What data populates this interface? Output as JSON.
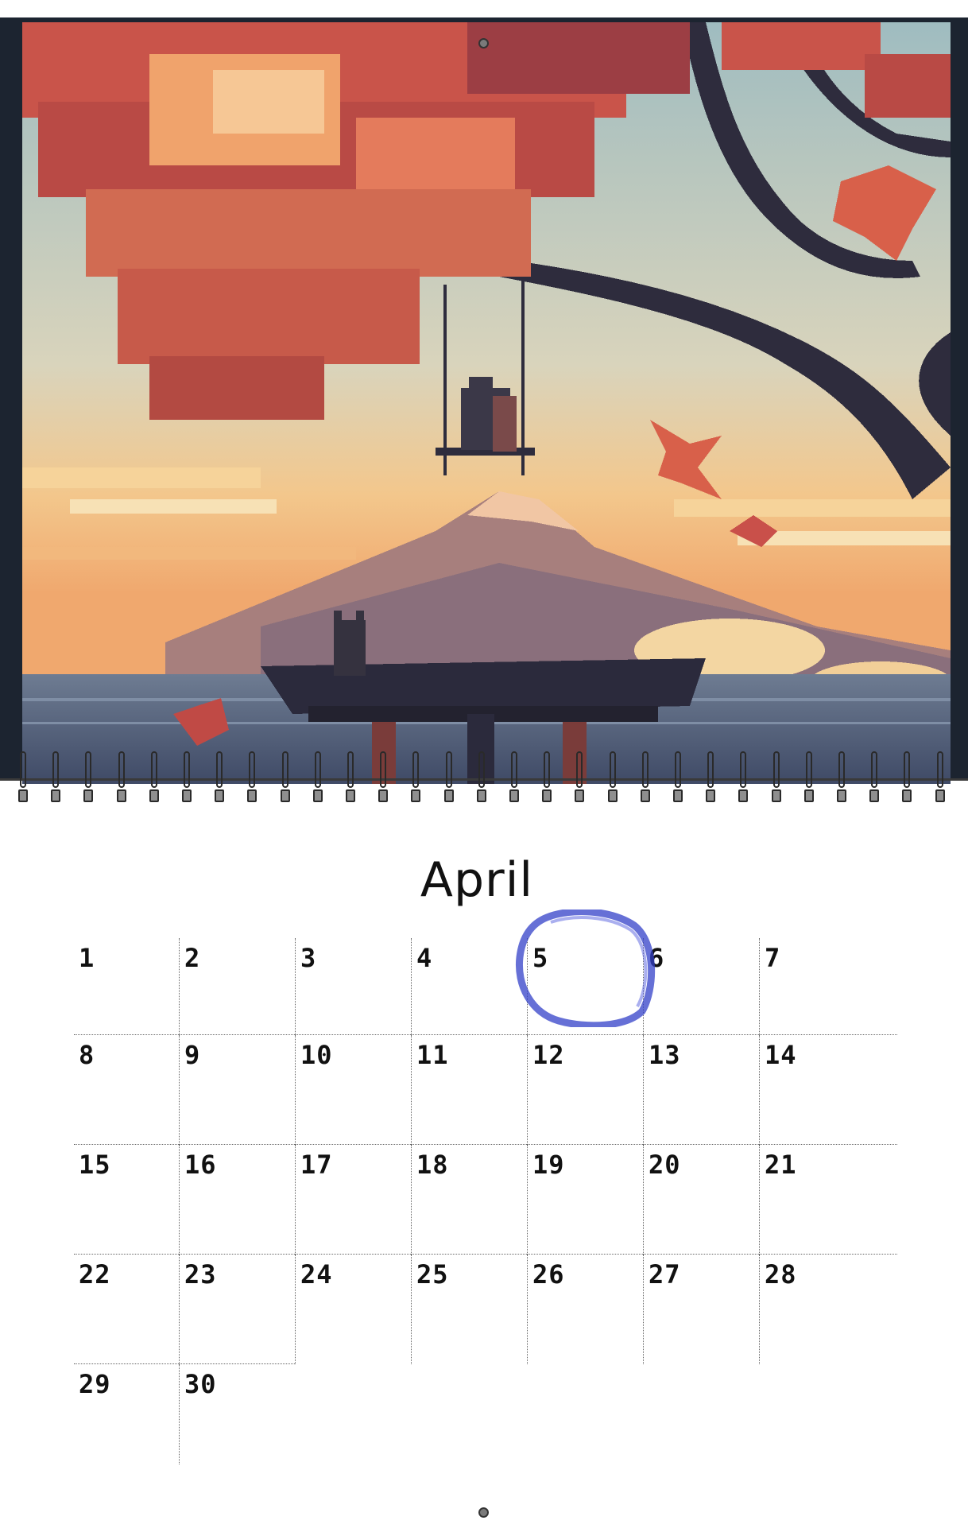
{
  "calendar": {
    "month": "April",
    "highlighted_day": "5",
    "days": [
      "1",
      "2",
      "3",
      "4",
      "5",
      "6",
      "7",
      "8",
      "9",
      "10",
      "11",
      "12",
      "13",
      "14",
      "15",
      "16",
      "17",
      "18",
      "19",
      "20",
      "21",
      "22",
      "23",
      "24",
      "25",
      "26",
      "27",
      "28",
      "29",
      "30"
    ]
  },
  "artwork": {
    "subject": "pixel-art-autumn-scene",
    "colors": {
      "sky": "#a9c2c4",
      "sunset": "#f1c083",
      "leaves": "#d8604a",
      "branch": "#2e2c3d",
      "water": "#5b6a82",
      "mountain": "#b7847a"
    }
  },
  "marker": {
    "color": "#3340c8"
  }
}
